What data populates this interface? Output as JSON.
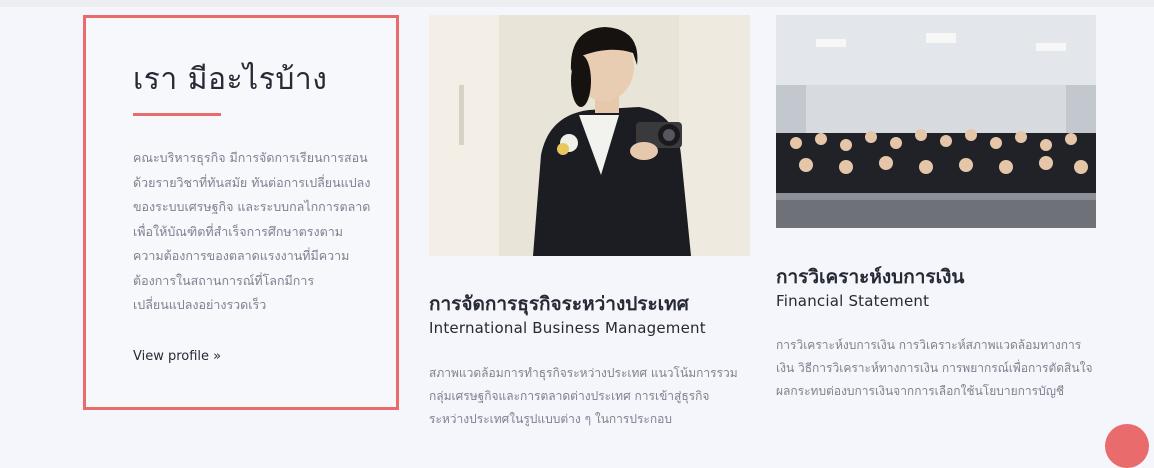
{
  "intro": {
    "title": "เรา มีอะไรบ้าง",
    "text": "คณะบริหารธุรกิจ มีการจัดการเรียนการสอนด้วยรายวิชาที่ทันสมัย ทันต่อการเปลี่ยนแปลงของระบบเศรษฐกิจ และระบบกลไกการตลาดเพื่อให้บัณฑิตที่สำเร็จการศึกษาตรงตามความต้องการของตลาดแรงงานที่มีความต้องการในสถานการณ์ที่โลกมีการเปลี่ยนแปลงอย่างรวดเร็ว",
    "link": "View profile »"
  },
  "cards": [
    {
      "title": "การจัดการธุรกิจระหว่างประเทศ",
      "subtitle": "International Business Management",
      "text": "สภาพแวดล้อมการทำธุรกิจระหว่างประเทศ แนวโน้มการรวมกลุ่มเศรษฐกิจและการตลาดต่างประเทศ การเข้าสู่ธุรกิจระหว่างประเทศในรูปแบบต่าง ๆ ในการประกอบ"
    },
    {
      "title": "การวิเคราะห์งบการเงิน",
      "subtitle": "Financial Statement",
      "text": "การวิเคราะห์งบการเงิน การวิเคราะห์สภาพแวดล้อมทางการเงิน วิธีการวิเคราะห์ทางการเงิน การพยากรณ์เพื่อการตัดสินใจ ผลกระทบต่องบการเงินจากการเลือกใช้นโยบายการบัญชี"
    }
  ],
  "colors": {
    "accent": "#e96b6b",
    "heading": "#262a35",
    "body": "#7d8290",
    "background": "#f4f6fb"
  }
}
